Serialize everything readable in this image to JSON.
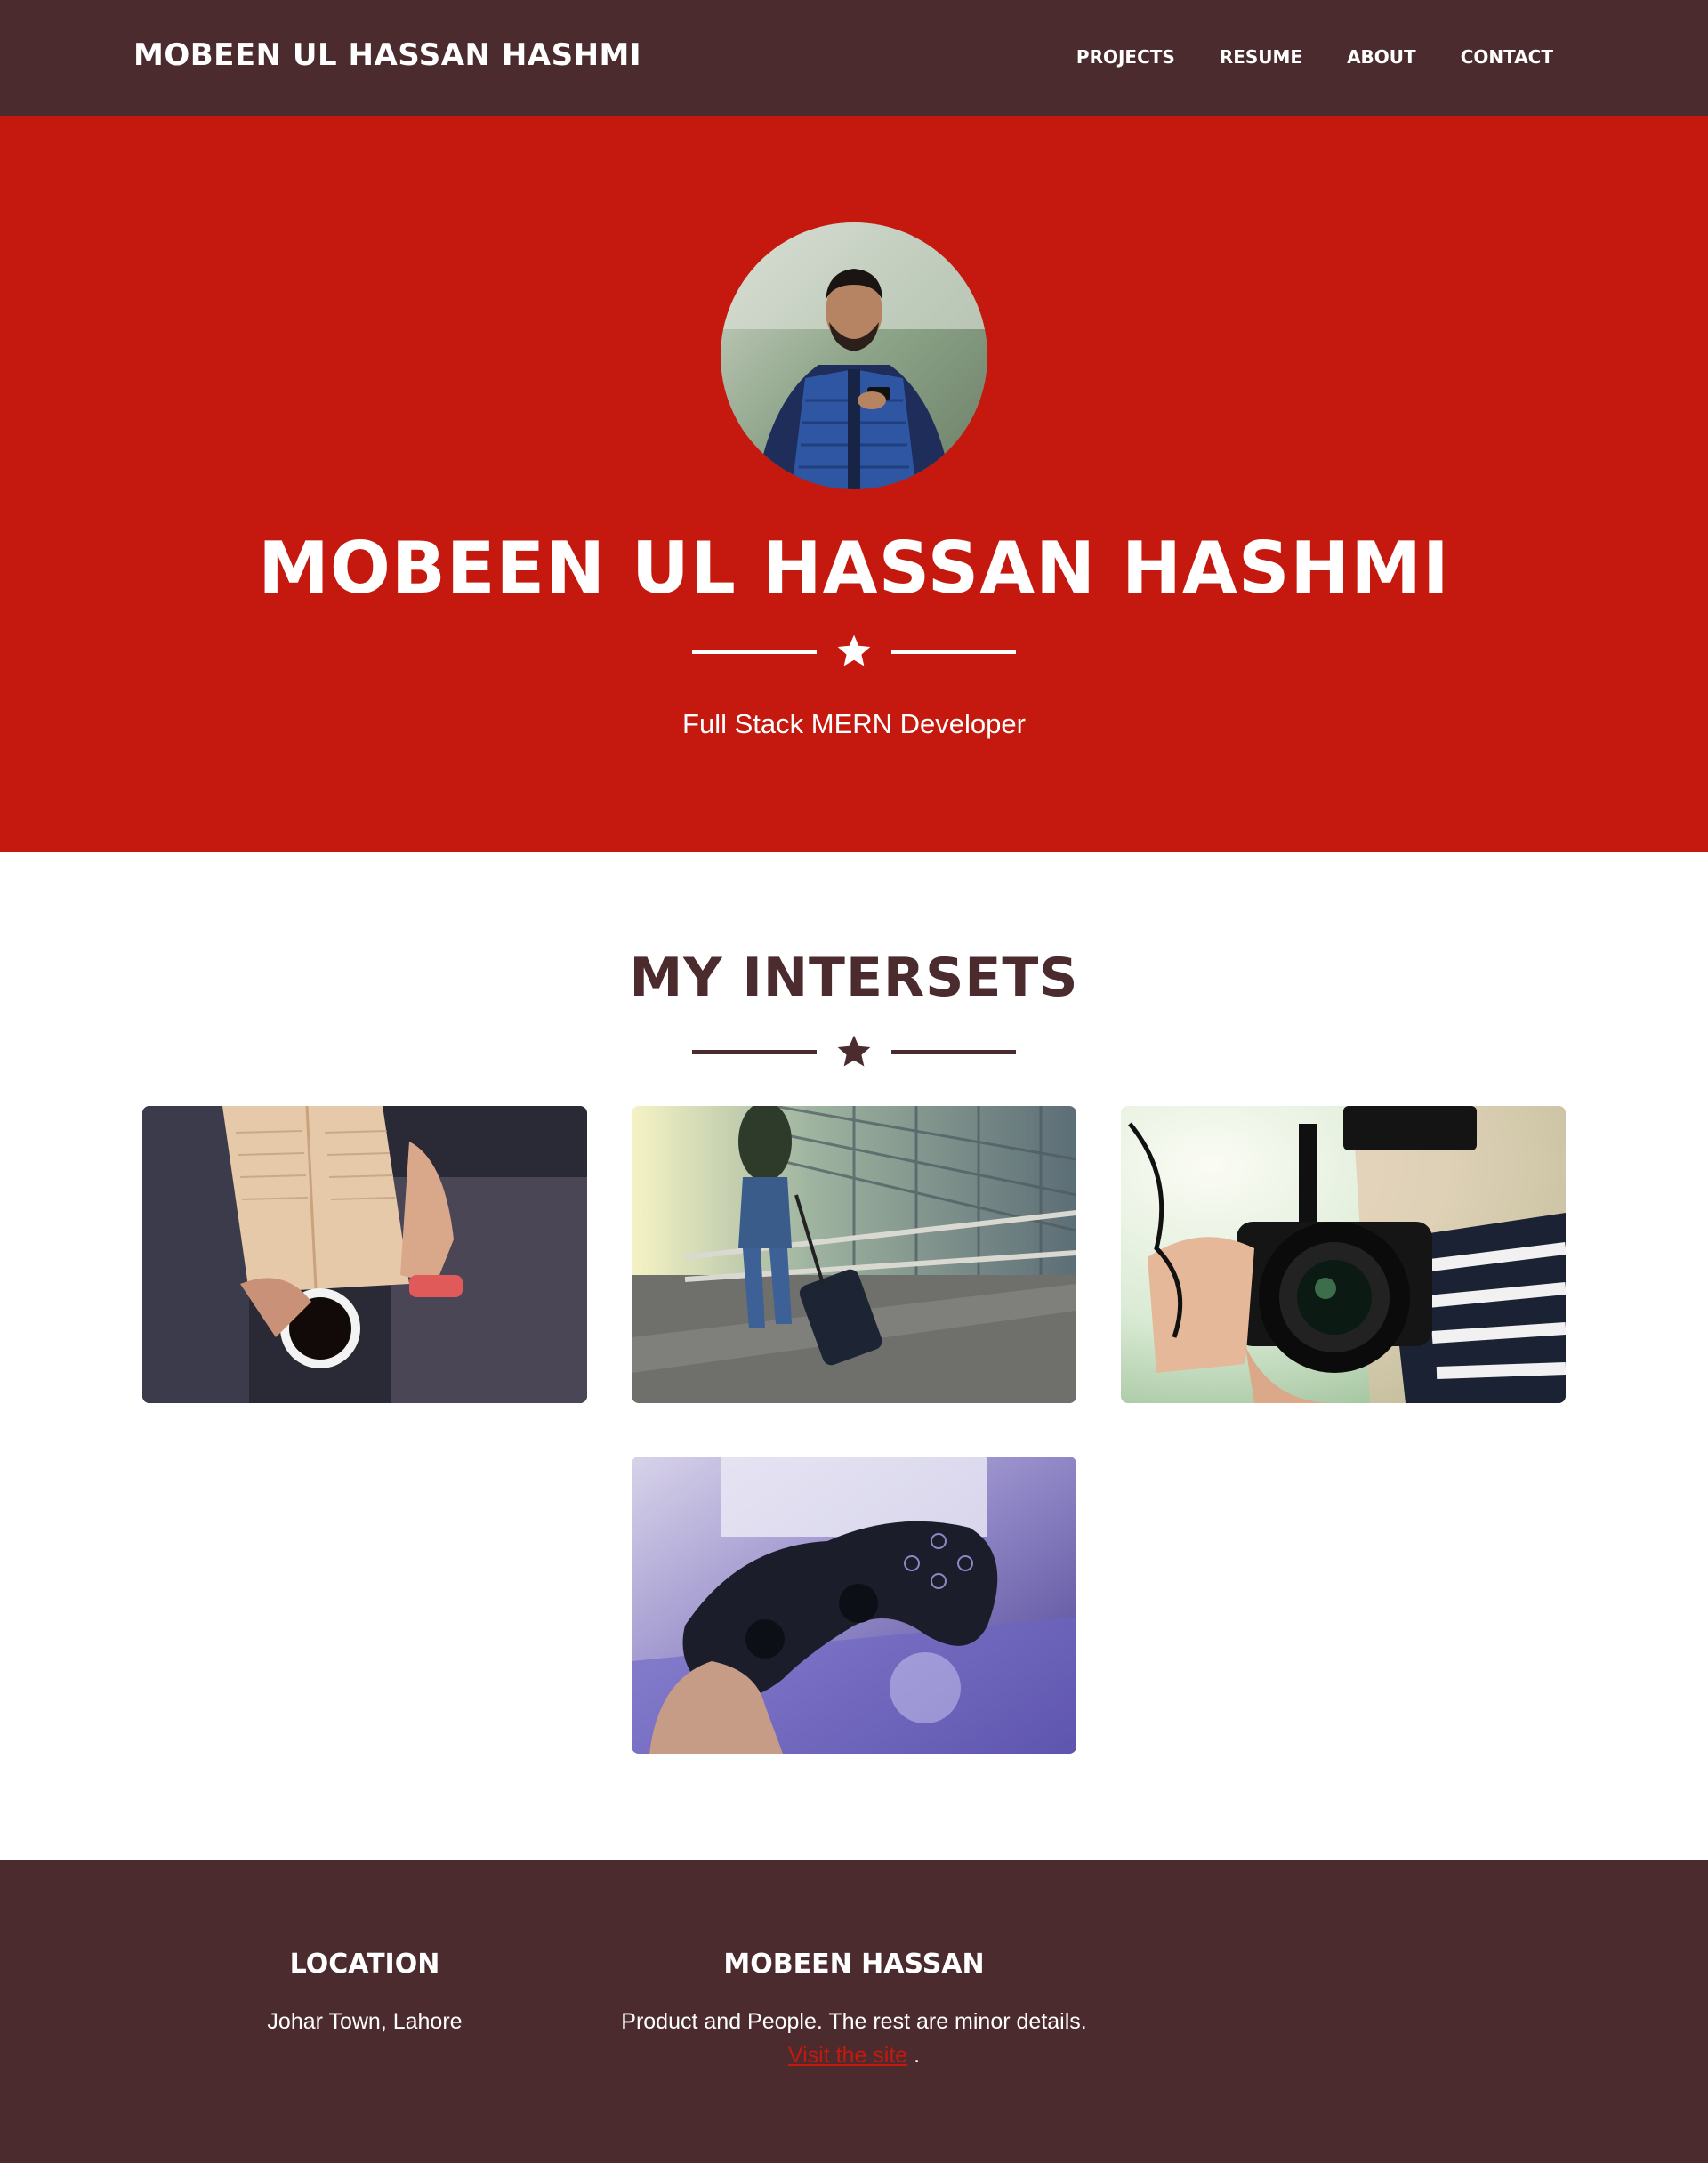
{
  "navbar": {
    "brand": "MOBEEN UL HASSAN HASHMI",
    "links": [
      "PROJECTS",
      "RESUME",
      "ABOUT",
      "CONTACT"
    ]
  },
  "hero": {
    "title": "MOBEEN UL HASSAN HASHMI",
    "subtitle": "Full Stack MERN Developer",
    "avatar_icon": "profile-photo"
  },
  "interests": {
    "title": "MY INTERSETS",
    "items": [
      "reading-photo",
      "travel-photo",
      "camera-photo",
      "gaming-photo"
    ]
  },
  "footer": {
    "location_heading": "LOCATION",
    "location_text": "Johar Town, Lahore",
    "about_heading": "MOBEEN HASSAN",
    "about_text": "Product and People. The rest are minor details.",
    "link_text": "Visit the site",
    "link_suffix": "."
  },
  "colors": {
    "navbar": "#4b2b2d",
    "hero": "#c5190f",
    "accent_text": "#4b2b2d",
    "footer": "#4b2b2d",
    "link": "#c5190f"
  }
}
